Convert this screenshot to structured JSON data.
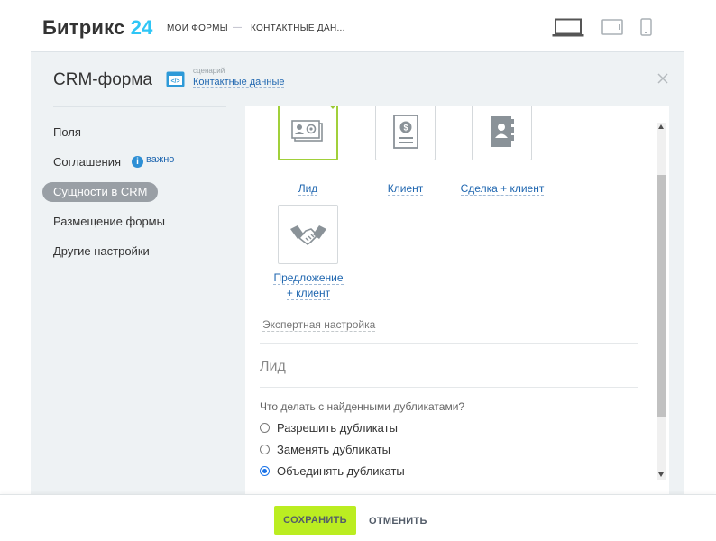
{
  "header": {
    "logo_text": "Битрикс",
    "logo_number": "24",
    "breadcrumb": [
      "МОИ ФОРМЫ",
      "КОНТАКТНЫЕ ДАН..."
    ],
    "separator": "—",
    "device_icons": [
      "laptop-icon",
      "tablet-icon",
      "phone-icon"
    ]
  },
  "panel": {
    "title": "CRM-форма",
    "scenario_label": "сценарий",
    "scenario_value": "Контактные данные",
    "close_icon": "close-icon"
  },
  "sidebar": {
    "items": [
      {
        "label": "Поля"
      },
      {
        "label": "Соглашения"
      },
      {
        "label": "Сущности в CRM"
      },
      {
        "label": "Размещение формы"
      },
      {
        "label": "Другие настройки"
      }
    ],
    "important_label": "важно",
    "important_icon": "i"
  },
  "entities": {
    "tiles": [
      {
        "label": "Лид",
        "icon": "lead-card-icon"
      },
      {
        "label": "Клиент",
        "icon": "client-document-icon"
      },
      {
        "label": "Сделка + клиент",
        "icon": "deal-contact-book-icon"
      },
      {
        "label_line1": "Предложение",
        "label_line2": "+ клиент",
        "icon": "handshake-icon"
      }
    ],
    "expert_link": "Экспертная настройка",
    "section_title": "Лид",
    "question": "Что делать с найденными дубликатами?",
    "options": [
      {
        "label": "Разрешить дубликаты",
        "checked": false
      },
      {
        "label": "Заменять дубликаты",
        "checked": false
      },
      {
        "label": "Объединять дубликаты",
        "checked": true
      }
    ]
  },
  "footer": {
    "save_label": "СОХРАНИТЬ",
    "cancel_label": "ОТМЕНИТЬ"
  },
  "colors": {
    "accent_green": "#bbed21",
    "link_blue": "#2067b0",
    "logo_blue": "#2fc6f6",
    "panel_bg": "#eef2f4"
  }
}
